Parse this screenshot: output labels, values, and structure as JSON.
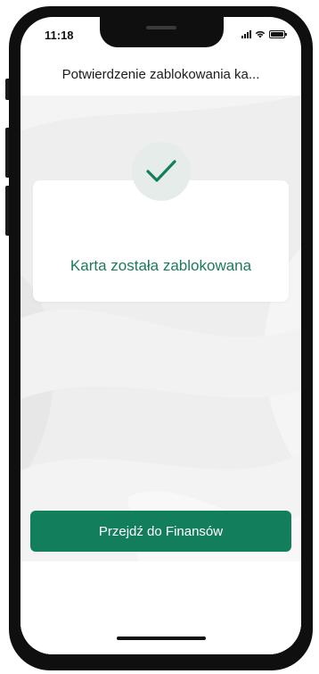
{
  "status_bar": {
    "time": "11:18"
  },
  "header": {
    "title": "Potwierdzenie zablokowania ka..."
  },
  "confirmation": {
    "message": "Karta została zablokowana",
    "icon": "checkmark-icon"
  },
  "actions": {
    "primary_label": "Przejdź do Finansów"
  },
  "colors": {
    "accent": "#137e5c",
    "message_text": "#1d7a5a",
    "background": "#efefef"
  }
}
